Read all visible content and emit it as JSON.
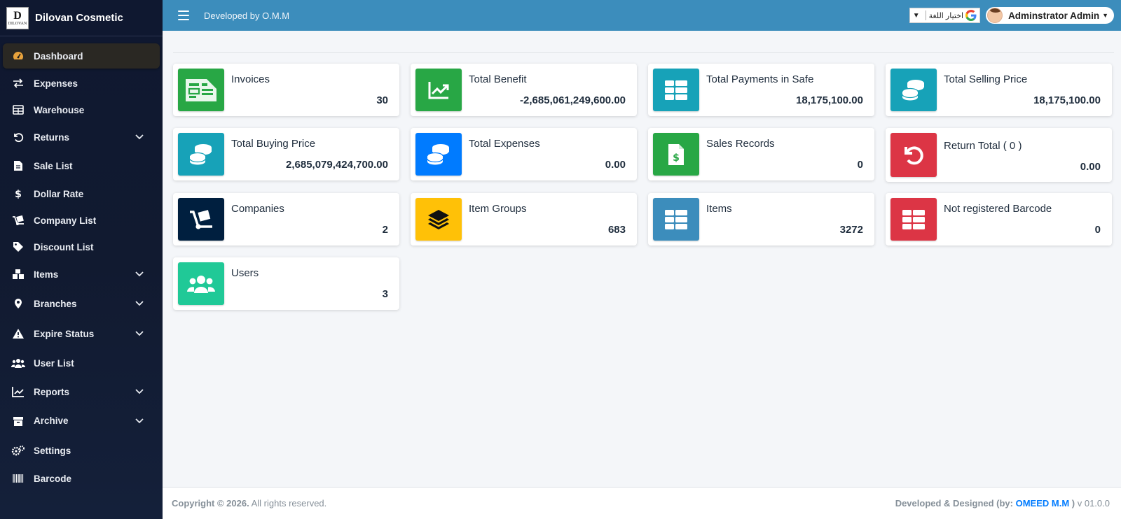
{
  "brand": {
    "title": "Dilovan Cosmetic",
    "logo_text": "DILOVAN"
  },
  "topbar": {
    "developed_by": "Developed by O.M.M",
    "language_label": "اختيار اللغة",
    "language_caret": "▼",
    "user_name": "Adminstrator Admin"
  },
  "sidebar": {
    "items": [
      {
        "label": "Dashboard",
        "icon": "tachometer-icon",
        "active": true,
        "has_children": false
      },
      {
        "label": "Expenses",
        "icon": "exchange-icon",
        "has_children": false
      },
      {
        "label": "Warehouse",
        "icon": "table-icon",
        "has_children": false
      },
      {
        "label": "Returns",
        "icon": "undo-icon",
        "has_children": true
      },
      {
        "label": "Sale List",
        "icon": "file-invoice-icon",
        "has_children": false
      },
      {
        "label": "Dollar Rate",
        "icon": "dollar-icon",
        "has_children": false
      },
      {
        "label": "Company List",
        "icon": "dolly-icon",
        "has_children": false
      },
      {
        "label": "Discount List",
        "icon": "tag-icon",
        "has_children": false
      },
      {
        "label": "Items",
        "icon": "boxes-icon",
        "has_children": true
      },
      {
        "label": "Branches",
        "icon": "map-marker-icon",
        "has_children": true
      },
      {
        "label": "Expire Status",
        "icon": "warning-icon",
        "has_children": true
      },
      {
        "label": "User List",
        "icon": "users-icon",
        "has_children": false
      },
      {
        "label": "Reports",
        "icon": "chart-line-icon",
        "has_children": true
      },
      {
        "label": "Archive",
        "icon": "archive-icon",
        "has_children": true
      },
      {
        "label": "Settings",
        "icon": "cogs-icon",
        "has_children": false
      },
      {
        "label": "Barcode",
        "icon": "barcode-icon",
        "has_children": false
      }
    ]
  },
  "cards": [
    {
      "title": "Invoices",
      "value": "30",
      "color": "#28a745",
      "icon": "invoice-icon"
    },
    {
      "title": "Total Benefit",
      "value": "-2,685,061,249,600.00",
      "color": "#28a745",
      "icon": "chart-line-icon"
    },
    {
      "title": "Total Payments in Safe",
      "value": "18,175,100.00",
      "color": "#17a2b8",
      "icon": "table-icon"
    },
    {
      "title": "Total Selling Price",
      "value": "18,175,100.00",
      "color": "#17a2b8",
      "icon": "coins-icon"
    },
    {
      "title": "Total Buying Price",
      "value": "2,685,079,424,700.00",
      "color": "#17a2b8",
      "icon": "coins-icon"
    },
    {
      "title": "Total Expenses",
      "value": "0.00",
      "color": "#007bff",
      "icon": "coins-icon"
    },
    {
      "title": "Sales Records",
      "value": "0",
      "color": "#28a745",
      "icon": "file-dollar-icon"
    },
    {
      "title": "Return Total ( 0 )",
      "value": "0.00",
      "color": "#dc3545",
      "icon": "undo-icon"
    },
    {
      "title": "Companies",
      "value": "2",
      "color": "#001f3f",
      "icon": "dolly-icon"
    },
    {
      "title": "Item Groups",
      "value": "683",
      "color": "#ffc107",
      "icon": "layer-group-icon"
    },
    {
      "title": "Items",
      "value": "3272",
      "color": "#3c8dbc",
      "icon": "table-icon"
    },
    {
      "title": "Not registered Barcode",
      "value": "0",
      "color": "#dc3545",
      "icon": "table-icon"
    },
    {
      "title": "Users",
      "value": "3",
      "color": "#20c997",
      "icon": "users-icon"
    }
  ],
  "footer": {
    "copyright_bold": "Copyright © 2026.",
    "copyright_rest": " All rights reserved.",
    "designed_prefix": "Developed & Designed (by: ",
    "designer": "OMEED M.M",
    "designed_suffix": " )",
    "version": " v 01.0.0"
  }
}
